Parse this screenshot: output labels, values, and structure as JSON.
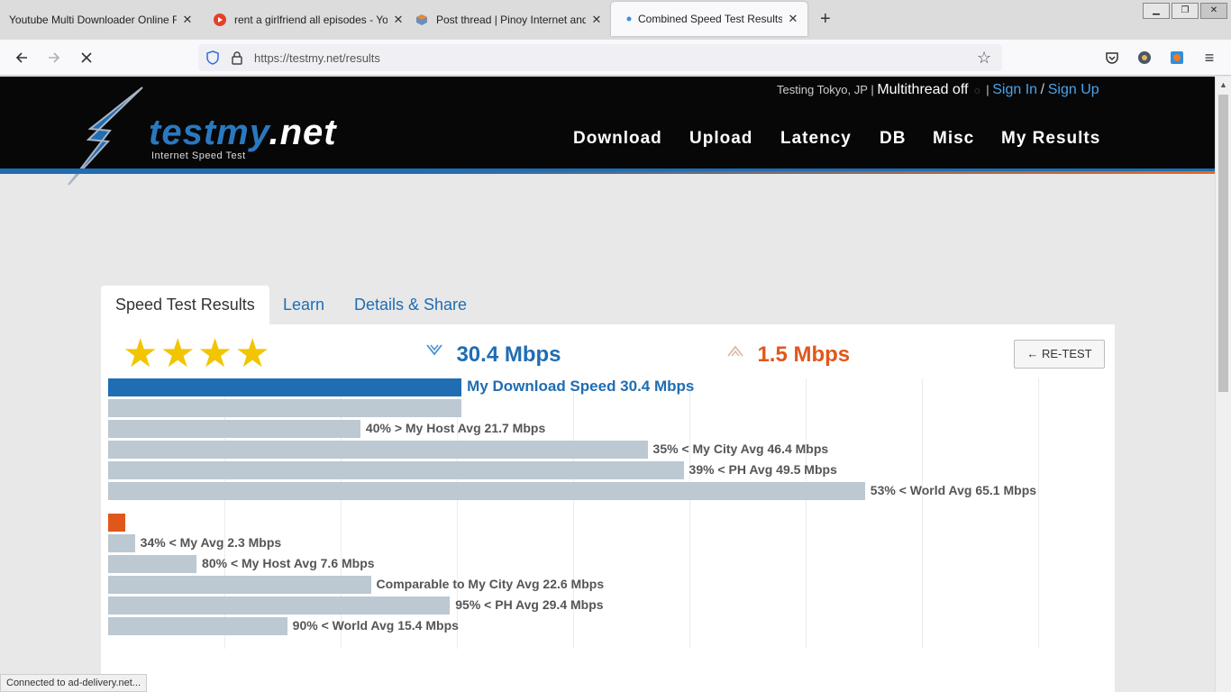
{
  "browser": {
    "tabs": [
      {
        "title": "Youtube Multi Downloader Online F",
        "icon": "none"
      },
      {
        "title": "rent a girlfriend all episodes - Yo",
        "icon": "youtube-icon"
      },
      {
        "title": "Post thread | Pinoy Internet and",
        "icon": "pinoy-icon"
      },
      {
        "title": "Combined Speed Test Results",
        "icon": "loading-dot-icon",
        "active": true
      }
    ],
    "url": "https://testmy.net/results",
    "status_text": "Connected to ad-delivery.net..."
  },
  "site": {
    "top": {
      "testing": "Testing Tokyo, JP",
      "separator": "|",
      "multithread": "Multithread off",
      "sign_in": "Sign In",
      "slash": "/",
      "sign_up": "Sign Up"
    },
    "logo": {
      "word": "testmy",
      "tld": ".net",
      "tagline": "Internet Speed Test"
    },
    "nav": [
      "Download",
      "Upload",
      "Latency",
      "DB",
      "Misc",
      "My Results"
    ],
    "tabs": [
      "Speed Test Results",
      "Learn",
      "Details & Share"
    ],
    "rating_stars": "★★★★",
    "download_summary": "30.4 Mbps",
    "upload_summary": "1.5 Mbps",
    "retest_label": "← RE-TEST",
    "colors": {
      "download": "#1f6db3",
      "upload": "#e0571c",
      "compare": "#bcc8d2",
      "header_bg": "#070707"
    }
  },
  "chart_data": {
    "type": "bar",
    "scale_max": 80,
    "groups": [
      {
        "name": "download",
        "bars": [
          {
            "value": 30.4,
            "label": "My Download Speed 30.4 Mbps",
            "kind": "primary"
          },
          {
            "value": 30.4,
            "label": "",
            "kind": "compare"
          },
          {
            "value": 21.7,
            "label": "40% > My Host Avg 21.7 Mbps",
            "kind": "compare"
          },
          {
            "value": 46.4,
            "label": "35% < My City Avg 46.4 Mbps",
            "kind": "compare"
          },
          {
            "value": 49.5,
            "label": "39% < PH Avg 49.5 Mbps",
            "kind": "compare"
          },
          {
            "value": 65.1,
            "label": "53% < World Avg 65.1 Mbps",
            "kind": "compare"
          }
        ]
      },
      {
        "name": "upload",
        "bars": [
          {
            "value": 1.5,
            "label": "",
            "kind": "primary"
          },
          {
            "value": 2.3,
            "label": "34% < My Avg 2.3 Mbps",
            "kind": "compare"
          },
          {
            "value": 7.6,
            "label": "80% < My Host Avg 7.6 Mbps",
            "kind": "compare"
          },
          {
            "value": 22.6,
            "label": "Comparable to My City Avg 22.6 Mbps",
            "kind": "compare"
          },
          {
            "value": 29.4,
            "label": "95% < PH Avg 29.4 Mbps",
            "kind": "compare"
          },
          {
            "value": 15.4,
            "label": "90% < World Avg 15.4 Mbps",
            "kind": "compare"
          }
        ]
      }
    ]
  }
}
